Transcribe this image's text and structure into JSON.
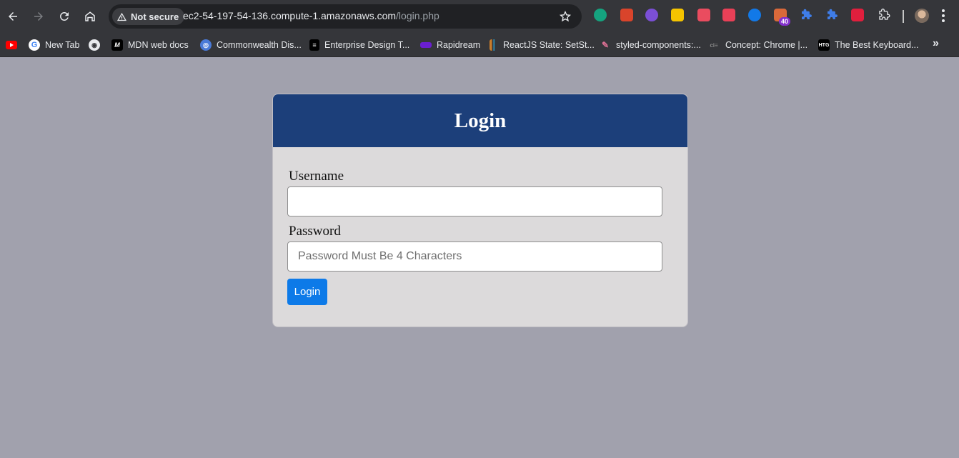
{
  "browser": {
    "security_label": "Not secure",
    "url_host": "ec2-54-197-54-136.compute-1.amazonaws.com",
    "url_path": "/login.php",
    "extension_badge": "40",
    "icons": [
      "back-icon",
      "forward-icon",
      "reload-icon",
      "home-icon",
      "star-icon",
      "extensions-icon",
      "profile-avatar",
      "menu-icon"
    ],
    "bookmarks": [
      {
        "label": "",
        "icon": "youtube-icon",
        "color": "#ff0000"
      },
      {
        "label": "New Tab",
        "icon": "google-icon",
        "color": "#ffffff"
      },
      {
        "label": "",
        "icon": "globe-icon",
        "color": "#ffffff"
      },
      {
        "label": "MDN web docs",
        "icon": "mdn-icon",
        "color": "#000000"
      },
      {
        "label": "Commonwealth Dis...",
        "icon": "globe-icon",
        "color": "#4a7bd8"
      },
      {
        "label": "Enterprise Design T...",
        "icon": "ibm-icon",
        "color": "#000000"
      },
      {
        "label": "Rapidream",
        "icon": "rapidream-icon",
        "color": "#6a1fd0"
      },
      {
        "label": "ReactJS State: SetSt...",
        "icon": "bars-icon",
        "color": "#c97d2c"
      },
      {
        "label": "styled-components:...",
        "icon": "styled-icon",
        "color": "#db7093"
      },
      {
        "label": "Concept: Chrome |...",
        "icon": "ciex-icon",
        "color": "#555555"
      },
      {
        "label": "The Best Keyboard...",
        "icon": "htg-icon",
        "color": "#000000"
      }
    ],
    "bookmarks_more": "»"
  },
  "login": {
    "title": "Login",
    "username_label": "Username",
    "username_value": "",
    "password_label": "Password",
    "password_placeholder": "Password Must Be 4 Characters",
    "submit_label": "Login",
    "header_color": "#1c3f7a",
    "button_color": "#0d7ae8"
  }
}
